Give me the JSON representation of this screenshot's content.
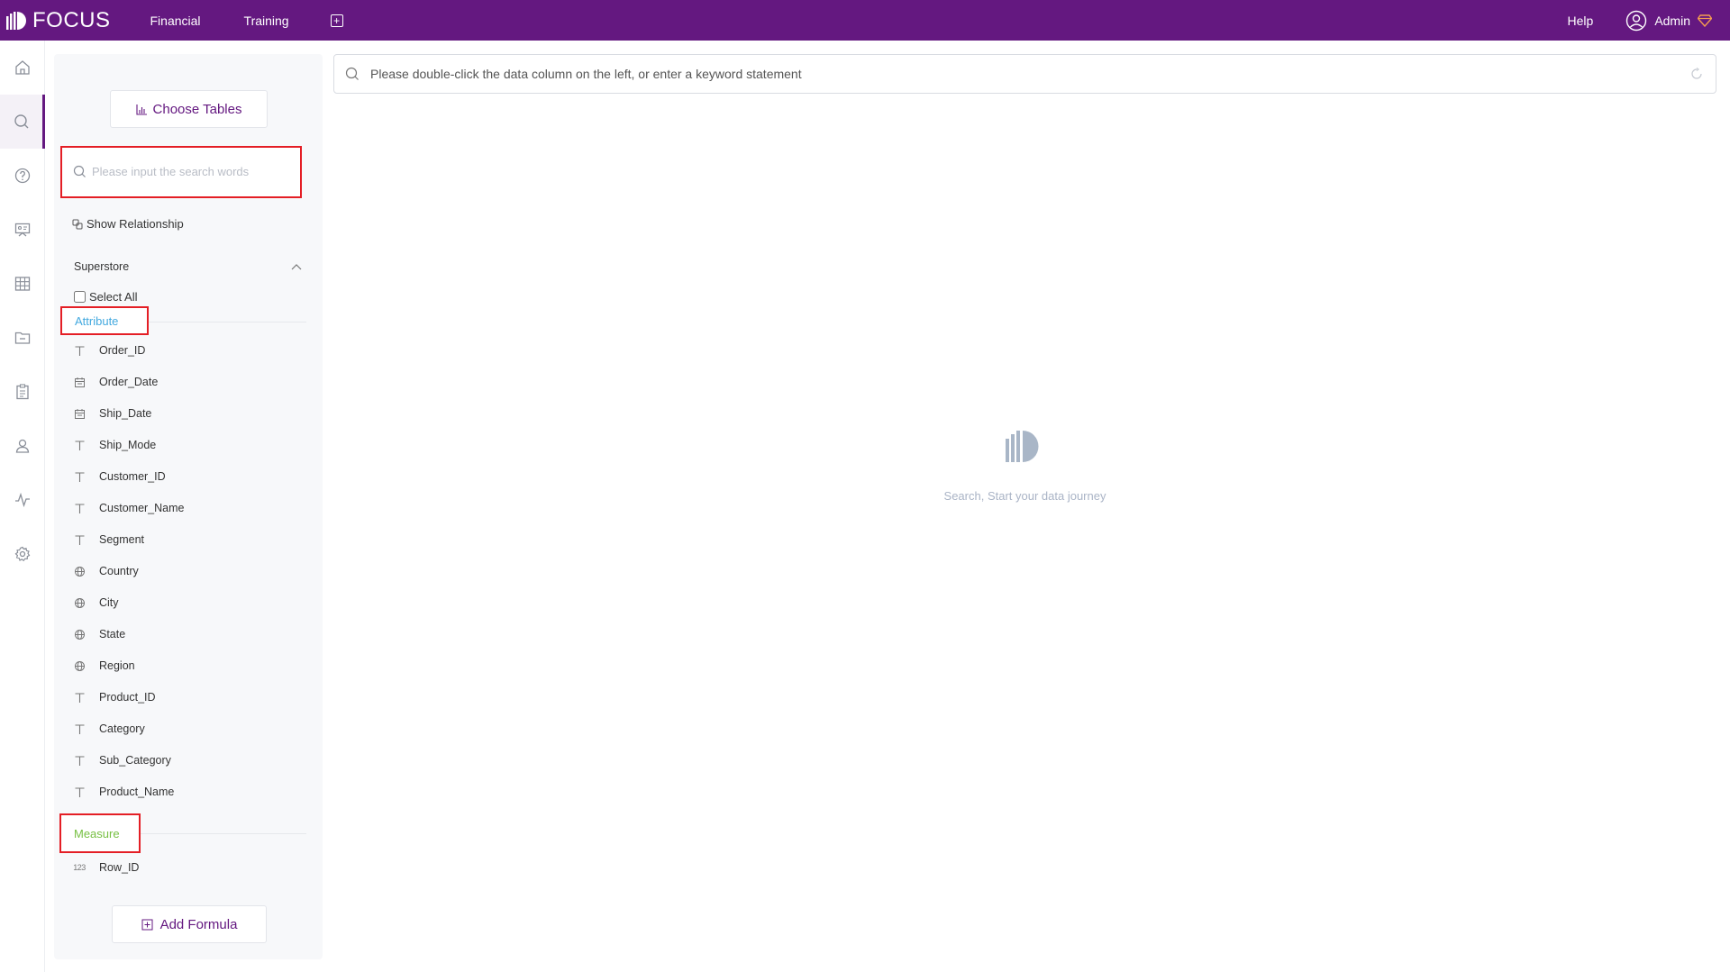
{
  "app": {
    "logo_text": "FOCUS",
    "brand_color": "#641880"
  },
  "topnav": {
    "items": [
      {
        "label": "Financial"
      },
      {
        "label": "Training"
      }
    ],
    "add_tab_icon": "plus-square-icon",
    "help_label": "Help",
    "user_label": "Admin"
  },
  "rail": {
    "items": [
      {
        "icon": "home-icon",
        "active": false
      },
      {
        "icon": "search-icon",
        "active": true
      },
      {
        "icon": "question-icon",
        "active": false
      },
      {
        "icon": "presentation-icon",
        "active": false
      },
      {
        "icon": "table-grid-icon",
        "active": false
      },
      {
        "icon": "folder-icon",
        "active": false
      },
      {
        "icon": "clipboard-icon",
        "active": false
      },
      {
        "icon": "user-icon",
        "active": false
      },
      {
        "icon": "pulse-icon",
        "active": false
      },
      {
        "icon": "settings-icon",
        "active": false
      }
    ]
  },
  "panel": {
    "choose_tables_label": "Choose Tables",
    "search_placeholder": "Please input the search words",
    "show_relationship_label": "Show Relationship",
    "table_name": "Superstore",
    "select_all_label": "Select All",
    "attribute_label": "Attribute",
    "attribute_color": "#43a9df",
    "measure_label": "Measure",
    "measure_color": "#77c043",
    "attributes": [
      {
        "name": "Order_ID",
        "type": "text-icon"
      },
      {
        "name": "Order_Date",
        "type": "calendar-icon"
      },
      {
        "name": "Ship_Date",
        "type": "calendar-icon"
      },
      {
        "name": "Ship_Mode",
        "type": "text-icon"
      },
      {
        "name": "Customer_ID",
        "type": "text-icon"
      },
      {
        "name": "Customer_Name",
        "type": "text-icon"
      },
      {
        "name": "Segment",
        "type": "text-icon"
      },
      {
        "name": "Country",
        "type": "globe-icon"
      },
      {
        "name": "City",
        "type": "globe-icon"
      },
      {
        "name": "State",
        "type": "globe-icon"
      },
      {
        "name": "Region",
        "type": "globe-icon"
      },
      {
        "name": "Product_ID",
        "type": "text-icon"
      },
      {
        "name": "Category",
        "type": "text-icon"
      },
      {
        "name": "Sub_Category",
        "type": "text-icon"
      },
      {
        "name": "Product_Name",
        "type": "text-icon"
      }
    ],
    "measures": [
      {
        "name": "Row_ID",
        "type": "number-icon",
        "glyph": "123"
      }
    ],
    "add_formula_label": "Add Formula"
  },
  "main": {
    "search_placeholder": "Please double-click the data column on the left, or enter a keyword statement",
    "empty_state_text": "Search, Start your data journey"
  }
}
